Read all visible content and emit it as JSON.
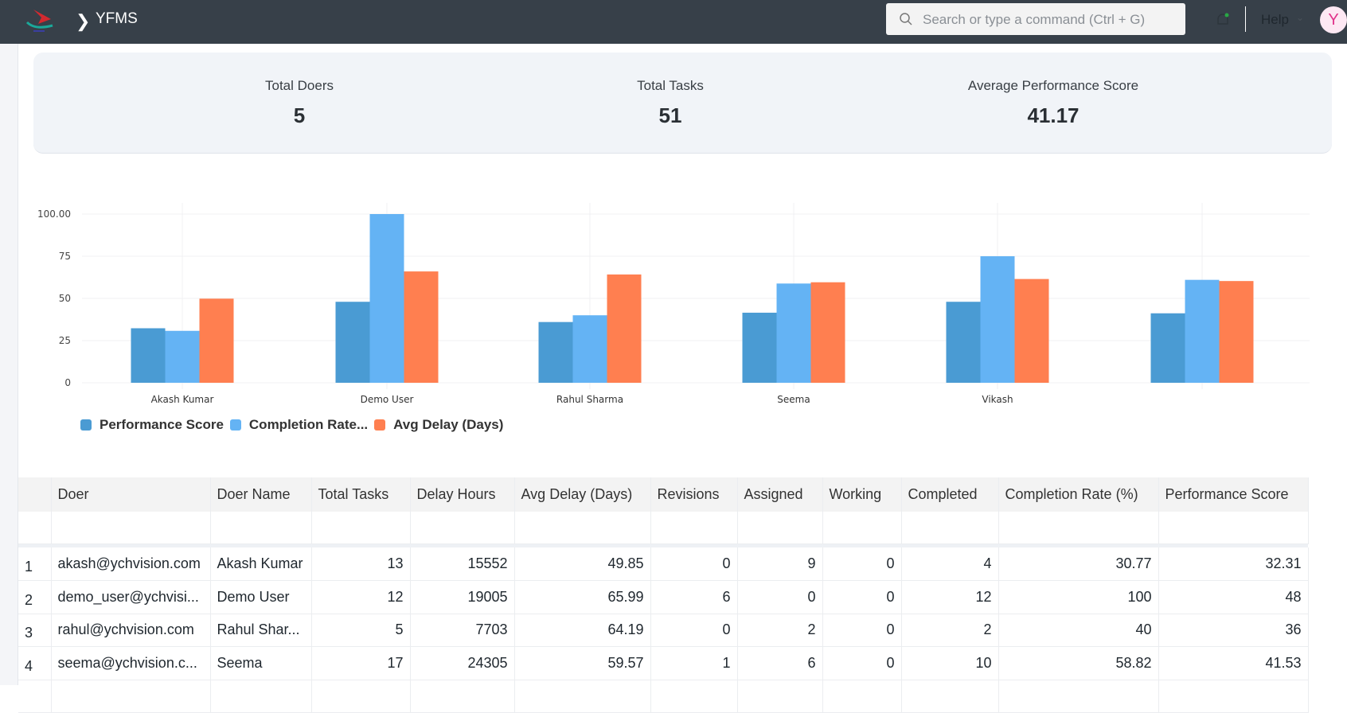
{
  "header": {
    "breadcrumb": "YFMS",
    "search_placeholder": "Search or type a command (Ctrl + G)",
    "help_label": "Help",
    "avatar_initial": "Y"
  },
  "stats": [
    {
      "label": "Total Doers",
      "value": "5"
    },
    {
      "label": "Total Tasks",
      "value": "51"
    },
    {
      "label": "Average Performance Score",
      "value": "41.17"
    }
  ],
  "chart_data": {
    "type": "bar",
    "categories": [
      "Akash Kumar",
      "Demo User",
      "Rahul Sharma",
      "Seema",
      "Vikash",
      ""
    ],
    "series": [
      {
        "name": "Performance Score",
        "color": "#4a9bd3",
        "values": [
          32.31,
          48,
          36,
          41.53,
          48,
          41.17
        ]
      },
      {
        "name": "Completion Rate...",
        "color": "#64b3f4",
        "values": [
          30.77,
          100,
          40,
          58.82,
          75,
          61
        ]
      },
      {
        "name": "Avg Delay (Days)",
        "color": "#ff7f50",
        "values": [
          49.85,
          65.99,
          64.19,
          59.57,
          61.5,
          60.3
        ]
      }
    ],
    "yticks": [
      "0",
      "25",
      "50",
      "75",
      "100.00"
    ],
    "ylim": [
      0,
      100
    ],
    "grid": true,
    "legend": "bottom-left"
  },
  "table": {
    "columns": [
      "",
      "Doer",
      "Doer Name",
      "Total Tasks",
      "Delay Hours",
      "Avg Delay (Days)",
      "Revisions",
      "Assigned",
      "Working",
      "Completed",
      "Completion Rate (%)",
      "Performance Score"
    ],
    "rows": [
      [
        "1",
        "akash@ychvision.com",
        "Akash Kumar",
        "13",
        "15552",
        "49.85",
        "0",
        "9",
        "0",
        "4",
        "30.77",
        "32.31"
      ],
      [
        "2",
        "demo_user@ychvisi...",
        "Demo User",
        "12",
        "19005",
        "65.99",
        "6",
        "0",
        "0",
        "12",
        "100",
        "48"
      ],
      [
        "3",
        "rahul@ychvision.com",
        "Rahul Shar...",
        "5",
        "7703",
        "64.19",
        "0",
        "2",
        "0",
        "2",
        "40",
        "36"
      ],
      [
        "4",
        "seema@ychvision.c...",
        "Seema",
        "17",
        "24305",
        "59.57",
        "1",
        "6",
        "0",
        "10",
        "58.82",
        "41.53"
      ]
    ]
  }
}
